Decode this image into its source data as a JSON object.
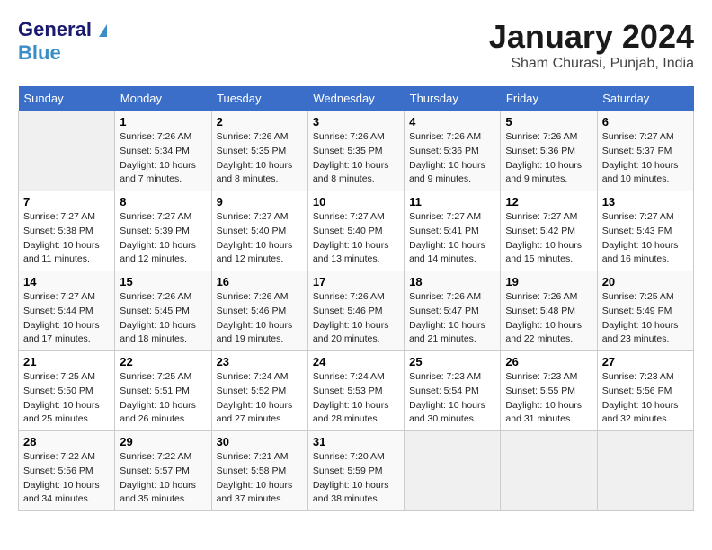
{
  "logo": {
    "line1": "General",
    "line2": "Blue"
  },
  "title": "January 2024",
  "subtitle": "Sham Churasi, Punjab, India",
  "days_of_week": [
    "Sunday",
    "Monday",
    "Tuesday",
    "Wednesday",
    "Thursday",
    "Friday",
    "Saturday"
  ],
  "weeks": [
    [
      {
        "day": "",
        "sunrise": "",
        "sunset": "",
        "daylight": ""
      },
      {
        "day": "1",
        "sunrise": "Sunrise: 7:26 AM",
        "sunset": "Sunset: 5:34 PM",
        "daylight": "Daylight: 10 hours and 7 minutes."
      },
      {
        "day": "2",
        "sunrise": "Sunrise: 7:26 AM",
        "sunset": "Sunset: 5:35 PM",
        "daylight": "Daylight: 10 hours and 8 minutes."
      },
      {
        "day": "3",
        "sunrise": "Sunrise: 7:26 AM",
        "sunset": "Sunset: 5:35 PM",
        "daylight": "Daylight: 10 hours and 8 minutes."
      },
      {
        "day": "4",
        "sunrise": "Sunrise: 7:26 AM",
        "sunset": "Sunset: 5:36 PM",
        "daylight": "Daylight: 10 hours and 9 minutes."
      },
      {
        "day": "5",
        "sunrise": "Sunrise: 7:26 AM",
        "sunset": "Sunset: 5:36 PM",
        "daylight": "Daylight: 10 hours and 9 minutes."
      },
      {
        "day": "6",
        "sunrise": "Sunrise: 7:27 AM",
        "sunset": "Sunset: 5:37 PM",
        "daylight": "Daylight: 10 hours and 10 minutes."
      }
    ],
    [
      {
        "day": "7",
        "sunrise": "Sunrise: 7:27 AM",
        "sunset": "Sunset: 5:38 PM",
        "daylight": "Daylight: 10 hours and 11 minutes."
      },
      {
        "day": "8",
        "sunrise": "Sunrise: 7:27 AM",
        "sunset": "Sunset: 5:39 PM",
        "daylight": "Daylight: 10 hours and 12 minutes."
      },
      {
        "day": "9",
        "sunrise": "Sunrise: 7:27 AM",
        "sunset": "Sunset: 5:40 PM",
        "daylight": "Daylight: 10 hours and 12 minutes."
      },
      {
        "day": "10",
        "sunrise": "Sunrise: 7:27 AM",
        "sunset": "Sunset: 5:40 PM",
        "daylight": "Daylight: 10 hours and 13 minutes."
      },
      {
        "day": "11",
        "sunrise": "Sunrise: 7:27 AM",
        "sunset": "Sunset: 5:41 PM",
        "daylight": "Daylight: 10 hours and 14 minutes."
      },
      {
        "day": "12",
        "sunrise": "Sunrise: 7:27 AM",
        "sunset": "Sunset: 5:42 PM",
        "daylight": "Daylight: 10 hours and 15 minutes."
      },
      {
        "day": "13",
        "sunrise": "Sunrise: 7:27 AM",
        "sunset": "Sunset: 5:43 PM",
        "daylight": "Daylight: 10 hours and 16 minutes."
      }
    ],
    [
      {
        "day": "14",
        "sunrise": "Sunrise: 7:27 AM",
        "sunset": "Sunset: 5:44 PM",
        "daylight": "Daylight: 10 hours and 17 minutes."
      },
      {
        "day": "15",
        "sunrise": "Sunrise: 7:26 AM",
        "sunset": "Sunset: 5:45 PM",
        "daylight": "Daylight: 10 hours and 18 minutes."
      },
      {
        "day": "16",
        "sunrise": "Sunrise: 7:26 AM",
        "sunset": "Sunset: 5:46 PM",
        "daylight": "Daylight: 10 hours and 19 minutes."
      },
      {
        "day": "17",
        "sunrise": "Sunrise: 7:26 AM",
        "sunset": "Sunset: 5:46 PM",
        "daylight": "Daylight: 10 hours and 20 minutes."
      },
      {
        "day": "18",
        "sunrise": "Sunrise: 7:26 AM",
        "sunset": "Sunset: 5:47 PM",
        "daylight": "Daylight: 10 hours and 21 minutes."
      },
      {
        "day": "19",
        "sunrise": "Sunrise: 7:26 AM",
        "sunset": "Sunset: 5:48 PM",
        "daylight": "Daylight: 10 hours and 22 minutes."
      },
      {
        "day": "20",
        "sunrise": "Sunrise: 7:25 AM",
        "sunset": "Sunset: 5:49 PM",
        "daylight": "Daylight: 10 hours and 23 minutes."
      }
    ],
    [
      {
        "day": "21",
        "sunrise": "Sunrise: 7:25 AM",
        "sunset": "Sunset: 5:50 PM",
        "daylight": "Daylight: 10 hours and 25 minutes."
      },
      {
        "day": "22",
        "sunrise": "Sunrise: 7:25 AM",
        "sunset": "Sunset: 5:51 PM",
        "daylight": "Daylight: 10 hours and 26 minutes."
      },
      {
        "day": "23",
        "sunrise": "Sunrise: 7:24 AM",
        "sunset": "Sunset: 5:52 PM",
        "daylight": "Daylight: 10 hours and 27 minutes."
      },
      {
        "day": "24",
        "sunrise": "Sunrise: 7:24 AM",
        "sunset": "Sunset: 5:53 PM",
        "daylight": "Daylight: 10 hours and 28 minutes."
      },
      {
        "day": "25",
        "sunrise": "Sunrise: 7:23 AM",
        "sunset": "Sunset: 5:54 PM",
        "daylight": "Daylight: 10 hours and 30 minutes."
      },
      {
        "day": "26",
        "sunrise": "Sunrise: 7:23 AM",
        "sunset": "Sunset: 5:55 PM",
        "daylight": "Daylight: 10 hours and 31 minutes."
      },
      {
        "day": "27",
        "sunrise": "Sunrise: 7:23 AM",
        "sunset": "Sunset: 5:56 PM",
        "daylight": "Daylight: 10 hours and 32 minutes."
      }
    ],
    [
      {
        "day": "28",
        "sunrise": "Sunrise: 7:22 AM",
        "sunset": "Sunset: 5:56 PM",
        "daylight": "Daylight: 10 hours and 34 minutes."
      },
      {
        "day": "29",
        "sunrise": "Sunrise: 7:22 AM",
        "sunset": "Sunset: 5:57 PM",
        "daylight": "Daylight: 10 hours and 35 minutes."
      },
      {
        "day": "30",
        "sunrise": "Sunrise: 7:21 AM",
        "sunset": "Sunset: 5:58 PM",
        "daylight": "Daylight: 10 hours and 37 minutes."
      },
      {
        "day": "31",
        "sunrise": "Sunrise: 7:20 AM",
        "sunset": "Sunset: 5:59 PM",
        "daylight": "Daylight: 10 hours and 38 minutes."
      },
      {
        "day": "",
        "sunrise": "",
        "sunset": "",
        "daylight": ""
      },
      {
        "day": "",
        "sunrise": "",
        "sunset": "",
        "daylight": ""
      },
      {
        "day": "",
        "sunrise": "",
        "sunset": "",
        "daylight": ""
      }
    ]
  ]
}
